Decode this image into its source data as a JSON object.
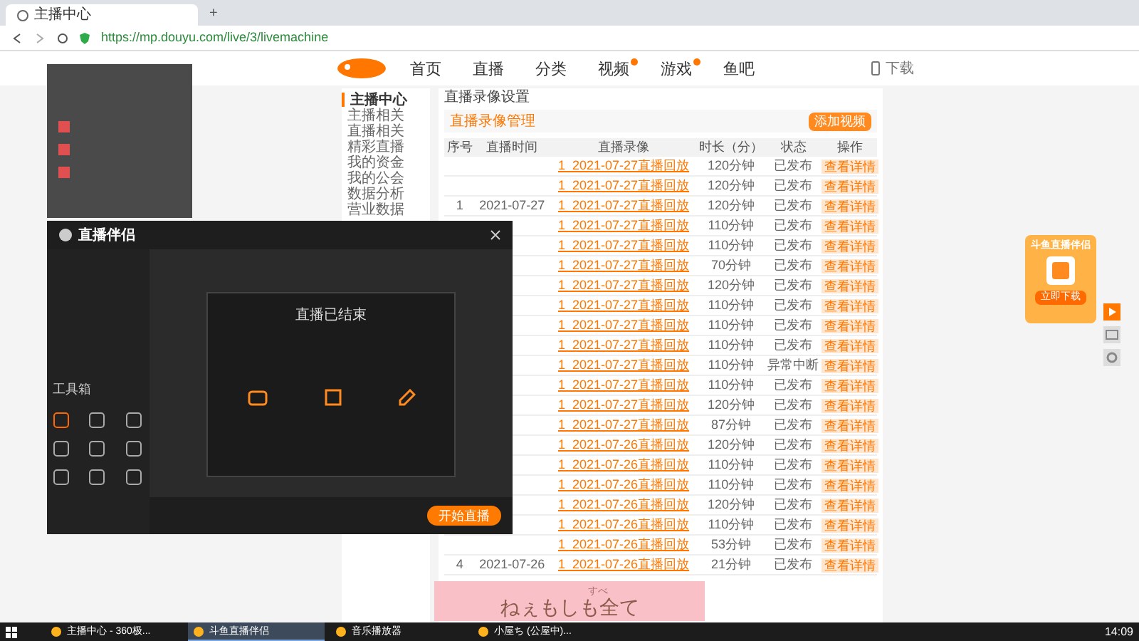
{
  "browser": {
    "tab_title": "主播中心",
    "new_tab": "+",
    "url": "https://mp.douyu.com/live/3/livemachine"
  },
  "site_nav": {
    "items": [
      {
        "label": "首页",
        "badge": false
      },
      {
        "label": "直播",
        "badge": false
      },
      {
        "label": "分类",
        "badge": false
      },
      {
        "label": "视频",
        "badge": true
      },
      {
        "label": "游戏",
        "badge": true
      },
      {
        "label": "鱼吧",
        "badge": false
      }
    ],
    "download": "下载"
  },
  "sidebar": {
    "title": "主播中心",
    "items": [
      {
        "label": "主播相关",
        "selected": false
      },
      {
        "label": "直播相关",
        "selected": false
      },
      {
        "label": "精彩直播",
        "selected": false
      },
      {
        "label": "我的资金",
        "selected": false
      },
      {
        "label": "我的公会",
        "selected": false
      },
      {
        "label": "数据分析",
        "selected": false
      },
      {
        "label": "营业数据",
        "selected": false
      }
    ]
  },
  "main": {
    "title": "直播录像设置",
    "section": "直播录像管理",
    "action_button": "添加视频"
  },
  "table": {
    "columns": [
      "序号",
      "直播时间",
      "直播录像",
      "时长（分）",
      "状态",
      "操作"
    ],
    "rows": [
      {
        "no": "",
        "date": "",
        "title": "1_2021-07-27直播回放",
        "duration": "120分钟",
        "status": "已发布",
        "action": "查看详情"
      },
      {
        "no": "",
        "date": "",
        "title": "1_2021-07-27直播回放",
        "duration": "120分钟",
        "status": "已发布",
        "action": "查看详情"
      },
      {
        "no": "1",
        "date": "2021-07-27",
        "title": "1_2021-07-27直播回放",
        "duration": "120分钟",
        "status": "已发布",
        "action": "查看详情"
      },
      {
        "no": "",
        "date": "",
        "title": "1_2021-07-27直播回放",
        "duration": "110分钟",
        "status": "已发布",
        "action": "查看详情"
      },
      {
        "no": "",
        "date": "",
        "title": "1_2021-07-27直播回放",
        "duration": "110分钟",
        "status": "已发布",
        "action": "查看详情"
      },
      {
        "no": "",
        "date": "",
        "title": "1_2021-07-27直播回放",
        "duration": "70分钟",
        "status": "已发布",
        "action": "查看详情"
      },
      {
        "no": "",
        "date": "",
        "title": "1_2021-07-27直播回放",
        "duration": "120分钟",
        "status": "已发布",
        "action": "查看详情"
      },
      {
        "no": "",
        "date": "",
        "title": "1_2021-07-27直播回放",
        "duration": "110分钟",
        "status": "已发布",
        "action": "查看详情"
      },
      {
        "no": "",
        "date": "",
        "title": "1_2021-07-27直播回放",
        "duration": "110分钟",
        "status": "已发布",
        "action": "查看详情"
      },
      {
        "no": "",
        "date": "",
        "title": "1_2021-07-27直播回放",
        "duration": "110分钟",
        "status": "已发布",
        "action": "查看详情"
      },
      {
        "no": "",
        "date": "",
        "title": "1_2021-07-27直播回放",
        "duration": "110分钟",
        "status": "异常中断",
        "action": "查看详情"
      },
      {
        "no": "",
        "date": "",
        "title": "1_2021-07-27直播回放",
        "duration": "110分钟",
        "status": "已发布",
        "action": "查看详情"
      },
      {
        "no": "",
        "date": "",
        "title": "1_2021-07-27直播回放",
        "duration": "120分钟",
        "status": "已发布",
        "action": "查看详情"
      },
      {
        "no": "",
        "date": "",
        "title": "1_2021-07-27直播回放",
        "duration": "87分钟",
        "status": "已发布",
        "action": "查看详情"
      },
      {
        "no": "",
        "date": "",
        "title": "1_2021-07-26直播回放",
        "duration": "120分钟",
        "status": "已发布",
        "action": "查看详情"
      },
      {
        "no": "",
        "date": "",
        "title": "1_2021-07-26直播回放",
        "duration": "110分钟",
        "status": "已发布",
        "action": "查看详情"
      },
      {
        "no": "",
        "date": "",
        "title": "1_2021-07-26直播回放",
        "duration": "110分钟",
        "status": "已发布",
        "action": "查看详情"
      },
      {
        "no": "",
        "date": "",
        "title": "1_2021-07-26直播回放",
        "duration": "120分钟",
        "status": "已发布",
        "action": "查看详情"
      },
      {
        "no": "",
        "date": "",
        "title": "1_2021-07-26直播回放",
        "duration": "110分钟",
        "status": "已发布",
        "action": "查看详情"
      },
      {
        "no": "",
        "date": "",
        "title": "1_2021-07-26直播回放",
        "duration": "53分钟",
        "status": "已发布",
        "action": "查看详情"
      },
      {
        "no": "4",
        "date": "2021-07-26",
        "title": "1_2021-07-26直播回放",
        "duration": "21分钟",
        "status": "已发布",
        "action": "查看详情"
      }
    ]
  },
  "app_window": {
    "title": "直播伴侣",
    "popup_title": "直播已结束",
    "toolbox_label": "工具箱",
    "start_button": "开始直播"
  },
  "promo": {
    "title": "斗鱼直播伴侣",
    "button": "立即下载"
  },
  "lyric": {
    "ruby": "すべ",
    "text": "ねぇもしも全て"
  },
  "taskbar": {
    "items": [
      {
        "label": "主播中心 - 360极...",
        "selected": false
      },
      {
        "label": "斗鱼直播伴侣",
        "selected": true
      },
      {
        "label": "音乐播放器",
        "selected": false
      },
      {
        "label": "小屋ち (公屋中)...",
        "selected": false
      }
    ],
    "time": "14:09"
  }
}
